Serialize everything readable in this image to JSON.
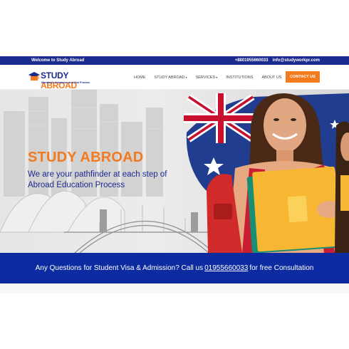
{
  "topbar": {
    "welcome": "Welcome to Study Abroad",
    "phone": "+8801955660033",
    "email": "info@studyworkpr.com"
  },
  "logo": {
    "word1": "STUDY",
    "word2": "ABROAD",
    "tagline": "Worldwide Admission and Visa Process"
  },
  "nav": {
    "items": [
      {
        "label": "HOME",
        "dropdown": false
      },
      {
        "label": "STUDY ABROAD",
        "dropdown": true
      },
      {
        "label": "SERVICES",
        "dropdown": true
      },
      {
        "label": "INSTITUTIONS",
        "dropdown": false
      },
      {
        "label": "ABOUT US",
        "dropdown": false
      }
    ],
    "cta": "CONTACT US"
  },
  "hero": {
    "title": "STUDY ABROAD",
    "subtitle": "We are your pathfinder at each step of Abroad Education Process"
  },
  "banner": {
    "text_before": "Any Questions for Student Visa & Admission? Call us",
    "phone": "01955660033",
    "text_after": "for free Consultation"
  },
  "colors": {
    "brand_blue": "#1b2a8f",
    "accent_orange": "#f47a20",
    "banner_blue": "#0c2ba0"
  }
}
